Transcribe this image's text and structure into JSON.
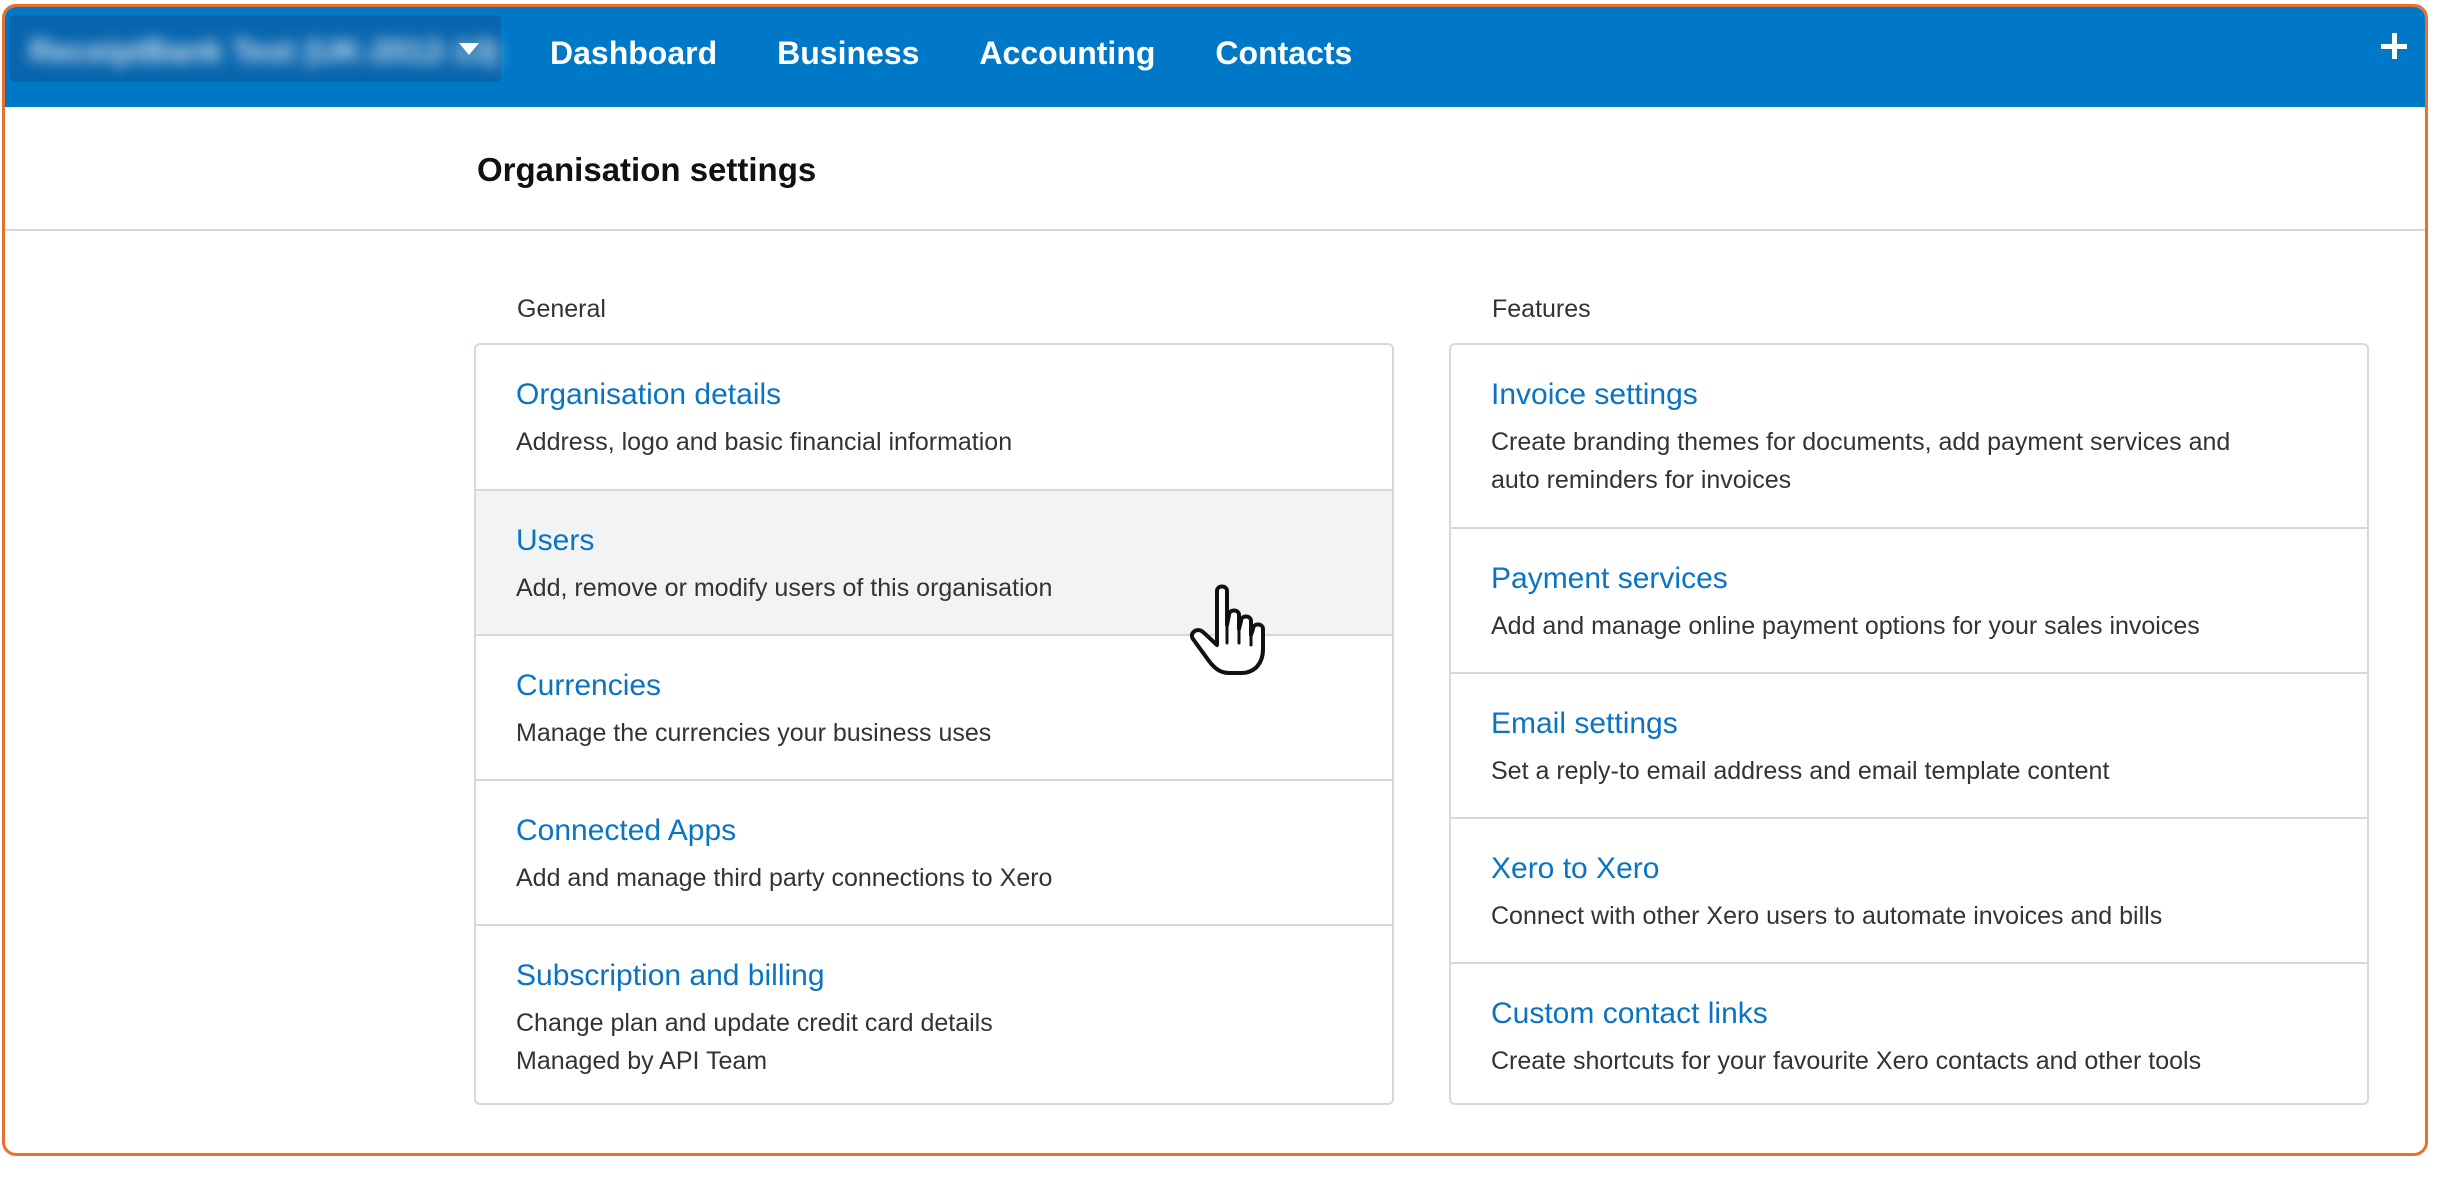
{
  "header": {
    "org_name": "ReceiptBank Test (UK-2012-13)",
    "nav": [
      "Dashboard",
      "Business",
      "Accounting",
      "Contacts"
    ]
  },
  "page": {
    "title": "Organisation settings"
  },
  "general": {
    "label": "General",
    "items": [
      {
        "title": "Organisation details",
        "desc": [
          "Address, logo and basic financial information"
        ]
      },
      {
        "title": "Users",
        "desc": [
          "Add, remove or modify users of this organisation"
        ]
      },
      {
        "title": "Currencies",
        "desc": [
          "Manage the currencies your business uses"
        ]
      },
      {
        "title": "Connected Apps",
        "desc": [
          "Add and manage third party connections to Xero"
        ]
      },
      {
        "title": "Subscription and billing",
        "desc": [
          "Change plan and update credit card details",
          "Managed by API Team"
        ]
      }
    ]
  },
  "features": {
    "label": "Features",
    "items": [
      {
        "title": "Invoice settings",
        "desc": [
          "Create branding themes for documents, add payment services and",
          "auto reminders for invoices"
        ]
      },
      {
        "title": "Payment services",
        "desc": [
          "Add and manage online payment options for your sales invoices"
        ]
      },
      {
        "title": "Email settings",
        "desc": [
          "Set a reply-to email address and email template content"
        ]
      },
      {
        "title": "Xero to Xero",
        "desc": [
          "Connect with other Xero users to automate invoices and bills"
        ]
      },
      {
        "title": "Custom contact links",
        "desc": [
          "Create shortcuts for your favourite Xero contacts and other tools"
        ]
      }
    ]
  },
  "colors": {
    "nav_blue": "#0078c8",
    "link_blue": "#0a74c3",
    "frame_orange": "#e8702a"
  },
  "icons": {
    "add": "plus-icon",
    "org_menu": "chevron-down-icon",
    "pointer": "hand-cursor-icon"
  }
}
